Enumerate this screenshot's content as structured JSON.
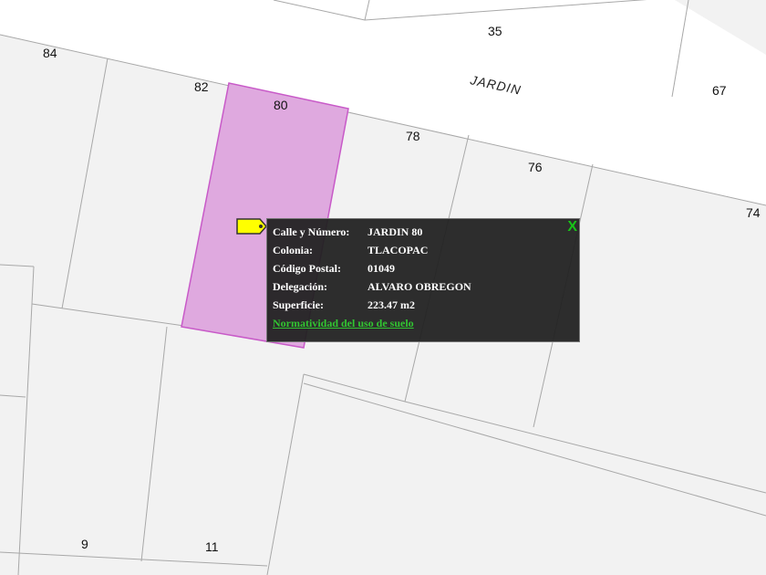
{
  "map": {
    "street_name": "JARDIN",
    "lot_numbers": [
      "35",
      "84",
      "82",
      "80",
      "78",
      "76",
      "67",
      "74",
      "9",
      "11"
    ],
    "colors": {
      "background": "#f2f2f2",
      "street": "#ffffff",
      "lot_line": "#a8a8a8",
      "selected_fill": "#dfa9df",
      "selected_border": "#c85ac8",
      "marker": "#ffff00"
    }
  },
  "marker": {
    "icon": "tag-marker-icon"
  },
  "popup": {
    "close_label": "X",
    "rows": [
      {
        "key": "Calle y Número:",
        "value": "JARDIN 80"
      },
      {
        "key": "Colonia:",
        "value": "TLACOPAC"
      },
      {
        "key": "Código Postal:",
        "value": "01049"
      },
      {
        "key": "Delegación:",
        "value": "ALVARO OBREGON"
      },
      {
        "key": "Superficie:",
        "value": "223.47 m2"
      }
    ],
    "link_label": "Normatividad del uso de suelo",
    "colors": {
      "background": "#222222",
      "text": "#ffffff",
      "link": "#31c431",
      "close": "#18c418"
    }
  }
}
